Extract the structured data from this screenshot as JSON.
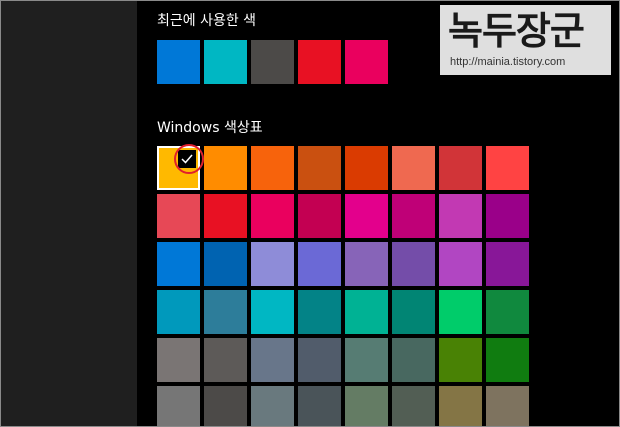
{
  "recent_section": {
    "title": "최근에 사용한 색",
    "colors": [
      "#0078d7",
      "#00b7c3",
      "#4c4a48",
      "#e81123",
      "#ea005e"
    ]
  },
  "palette_section": {
    "title": "Windows 색상표",
    "selected_index": 0,
    "colors": [
      "#ffb900",
      "#ff8c00",
      "#f7630c",
      "#ca5010",
      "#da3b01",
      "#ef6950",
      "#d13438",
      "#ff4343",
      "#e74856",
      "#e81123",
      "#ea005e",
      "#c30052",
      "#e3008c",
      "#bf0077",
      "#c239b3",
      "#9a0089",
      "#0078d7",
      "#0063b1",
      "#8e8cd8",
      "#6b69d6",
      "#8764b8",
      "#744da9",
      "#b146c2",
      "#881798",
      "#0099bc",
      "#2d7d9a",
      "#00b7c3",
      "#038387",
      "#00b294",
      "#018574",
      "#00cc6a",
      "#10893e",
      "#7a7574",
      "#5d5a58",
      "#68768a",
      "#515c6b",
      "#567c73",
      "#486860",
      "#498205",
      "#107c10",
      "#767676",
      "#4c4a48",
      "#69797e",
      "#4a5459",
      "#647c64",
      "#525e54",
      "#847545",
      "#7e735f"
    ]
  },
  "watermark": {
    "title": "녹두장군",
    "url": "http://mainia.tistory.com"
  }
}
